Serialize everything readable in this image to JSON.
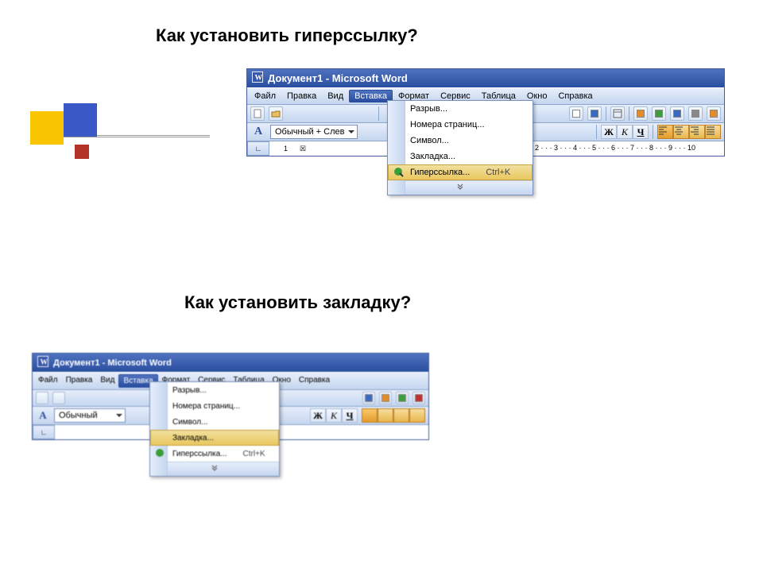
{
  "heading1": "Как установить гиперссылку?",
  "heading2": "Как установить закладку?",
  "win": {
    "title": "Документ1 - Microsoft Word",
    "menu": {
      "file": "Файл",
      "edit": "Правка",
      "view": "Вид",
      "insert": "Вставка",
      "format": "Формат",
      "tools": "Сервис",
      "table": "Таблица",
      "window": "Окно",
      "help": "Справка"
    },
    "insert_menu": {
      "break": "Разрыв...",
      "page_numbers": "Номера страниц...",
      "symbol": "Символ...",
      "bookmark": "Закладка...",
      "hyperlink": "Гиперссылка...",
      "hyperlink_shortcut": "Ctrl+K"
    },
    "style_combo": "Обычный + Слев",
    "style_prefix": "A",
    "bold": "Ж",
    "italic": "К",
    "underline": "Ч"
  },
  "win2": {
    "title": "Документ1 - Microsoft Word",
    "style_combo": "Обычный",
    "insert_menu": {
      "break": "Разрыв...",
      "page_numbers": "Номера страниц...",
      "symbol": "Символ...",
      "bookmark": "Закладка...",
      "hyperlink": "Гиперссылка...",
      "hyperlink_shortcut": "Ctrl+K"
    }
  }
}
